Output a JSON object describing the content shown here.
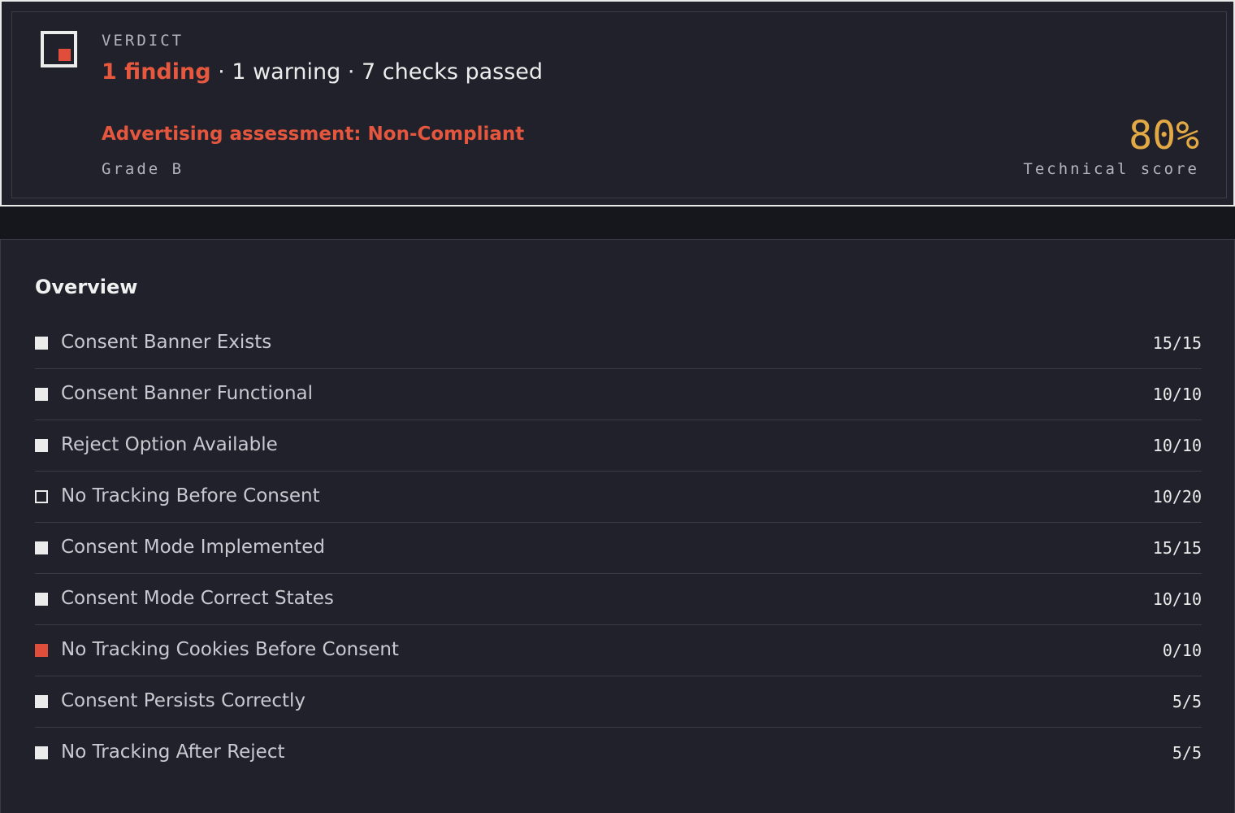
{
  "verdict": {
    "label": "VERDICT",
    "findings": "1 finding",
    "separator": "·",
    "warnings": "1 warning",
    "passed": "7 checks passed",
    "assessment": "Advertising assessment: Non-Compliant",
    "grade": "Grade B",
    "score": "80%",
    "score_label": "Technical score"
  },
  "overview": {
    "title": "Overview",
    "checks": [
      {
        "label": "Consent Banner Exists",
        "score": "15/15",
        "status": "pass"
      },
      {
        "label": "Consent Banner Functional",
        "score": "10/10",
        "status": "pass"
      },
      {
        "label": "Reject Option Available",
        "score": "10/10",
        "status": "pass"
      },
      {
        "label": "No Tracking Before Consent",
        "score": "10/20",
        "status": "partial"
      },
      {
        "label": "Consent Mode Implemented",
        "score": "15/15",
        "status": "pass"
      },
      {
        "label": "Consent Mode Correct States",
        "score": "10/10",
        "status": "pass"
      },
      {
        "label": "No Tracking Cookies Before Consent",
        "score": "0/10",
        "status": "fail"
      },
      {
        "label": "Consent Persists Correctly",
        "score": "5/5",
        "status": "pass"
      },
      {
        "label": "No Tracking After Reject",
        "score": "5/5",
        "status": "pass"
      }
    ]
  },
  "colors": {
    "background": "#20212a",
    "accent_red": "#e04e3b",
    "score_gold": "#e2a944",
    "text": "#ececec"
  }
}
